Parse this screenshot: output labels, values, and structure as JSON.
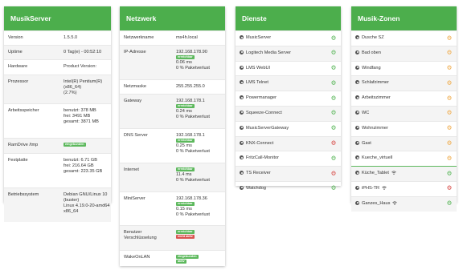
{
  "colors": {
    "header": "#4cae4c",
    "on": "#5cb85c",
    "off": "#d9534f",
    "standby": "#f0ad4e"
  },
  "server": {
    "title": "MusikServer",
    "rows": [
      {
        "label": "Version",
        "value": "1.5.5.0"
      },
      {
        "label": "Uptime",
        "value": "0 Tag(e) - 00:52:10"
      },
      {
        "label": "Hardware",
        "value": "Product Version:"
      },
      {
        "label": "Prozessor",
        "lines": [
          "Intel(R) Pentium(R)",
          "(x86_64)",
          "(2.7%)"
        ]
      },
      {
        "label": "Arbeitsspeicher",
        "lines": [
          "benutzt: 378 MB",
          "frei: 3491 MB",
          "gesamt: 3871 MB"
        ]
      },
      {
        "label": "RamDrive /tmp",
        "badge": "eingebunden"
      },
      {
        "label": "Festplatte",
        "lines": [
          "benutzt: 6.71 GB",
          "frei: 216.64 GB",
          "gesamt: 223.35 GB"
        ]
      },
      {
        "label": "Betriebssystem",
        "lines": [
          "Debian GNU/Linux 10",
          "(buster)",
          "Linux 4.19.0-20-amd64",
          "x86_64"
        ]
      }
    ]
  },
  "network": {
    "title": "Netzwerk",
    "rows": [
      {
        "label": "Netzwerkname",
        "value": "ms4h.local"
      },
      {
        "label": "IP-Adresse",
        "lines": [
          "192.168.178.90"
        ],
        "badge": "erreichbar",
        "after": [
          "0.06 ms",
          "0 % Paketverlust"
        ]
      },
      {
        "label": "Netzmaske",
        "value": "255.255.255.0"
      },
      {
        "label": "Gateway",
        "lines": [
          "192.168.178.1"
        ],
        "badge": "erreichbar",
        "after": [
          "0.24 ms",
          "0 % Paketverlust"
        ]
      },
      {
        "label": "DNS Server",
        "lines": [
          "192.168.178.1"
        ],
        "badge": "erreichbar",
        "after": [
          "0.25 ms",
          "0 % Paketverlust"
        ]
      },
      {
        "label": "Internet",
        "badge": "erreichbar",
        "after": [
          "11.4 ms",
          "0 % Paketverlust"
        ]
      },
      {
        "label": "MiniServer",
        "lines": [
          "192.168.178.36"
        ],
        "badge": "erreichbar",
        "after": [
          "0.15 ms",
          "0 % Paketverlust"
        ]
      },
      {
        "label": "Benutzer",
        "label2": "Verschlüsselung",
        "badge": "erreichbar",
        "badge2": "nicht aktiv"
      },
      {
        "label": "WakeOnLAN",
        "badge": "eingebunden",
        "badge2g": "aktiv"
      }
    ]
  },
  "services": {
    "title": "Dienste",
    "items": [
      {
        "name": "MusicServer",
        "state": "on"
      },
      {
        "name": "Logitech Media Server",
        "state": "on"
      },
      {
        "name": "LMS WebUI",
        "state": "on"
      },
      {
        "name": "LMS Telnet",
        "state": "on"
      },
      {
        "name": "Powermanager",
        "state": "on"
      },
      {
        "name": "Squeeze-Connect",
        "state": "on"
      },
      {
        "name": "MusicServerGateway",
        "state": "on"
      },
      {
        "name": "KNX-Connect",
        "state": "off"
      },
      {
        "name": "FritzCall-Monitor",
        "state": "on"
      },
      {
        "name": "TS Receiver",
        "state": "off"
      },
      {
        "name": "Watchdog",
        "state": "on"
      }
    ]
  },
  "zones": {
    "title": "Musik-Zonen",
    "items": [
      {
        "name": "Dusche SZ",
        "state": "standby"
      },
      {
        "name": "Bad oben",
        "state": "standby"
      },
      {
        "name": "Windfang",
        "state": "standby"
      },
      {
        "name": "Schlafzimmer",
        "state": "standby"
      },
      {
        "name": "Arbeitszimmer",
        "state": "standby"
      },
      {
        "name": "WC",
        "state": "standby"
      },
      {
        "name": "Wohnzimmer",
        "state": "standby"
      },
      {
        "name": "Gast",
        "state": "standby"
      },
      {
        "name": "Kueche_virtuell",
        "state": "standby"
      },
      {
        "name": "Küche_Tablet",
        "state": "on",
        "wifi": true
      },
      {
        "name": "iPHS-TR",
        "state": "off",
        "wifi": true
      },
      {
        "name": "Ganzes_Haus",
        "state": "on",
        "wifi": true
      }
    ]
  }
}
